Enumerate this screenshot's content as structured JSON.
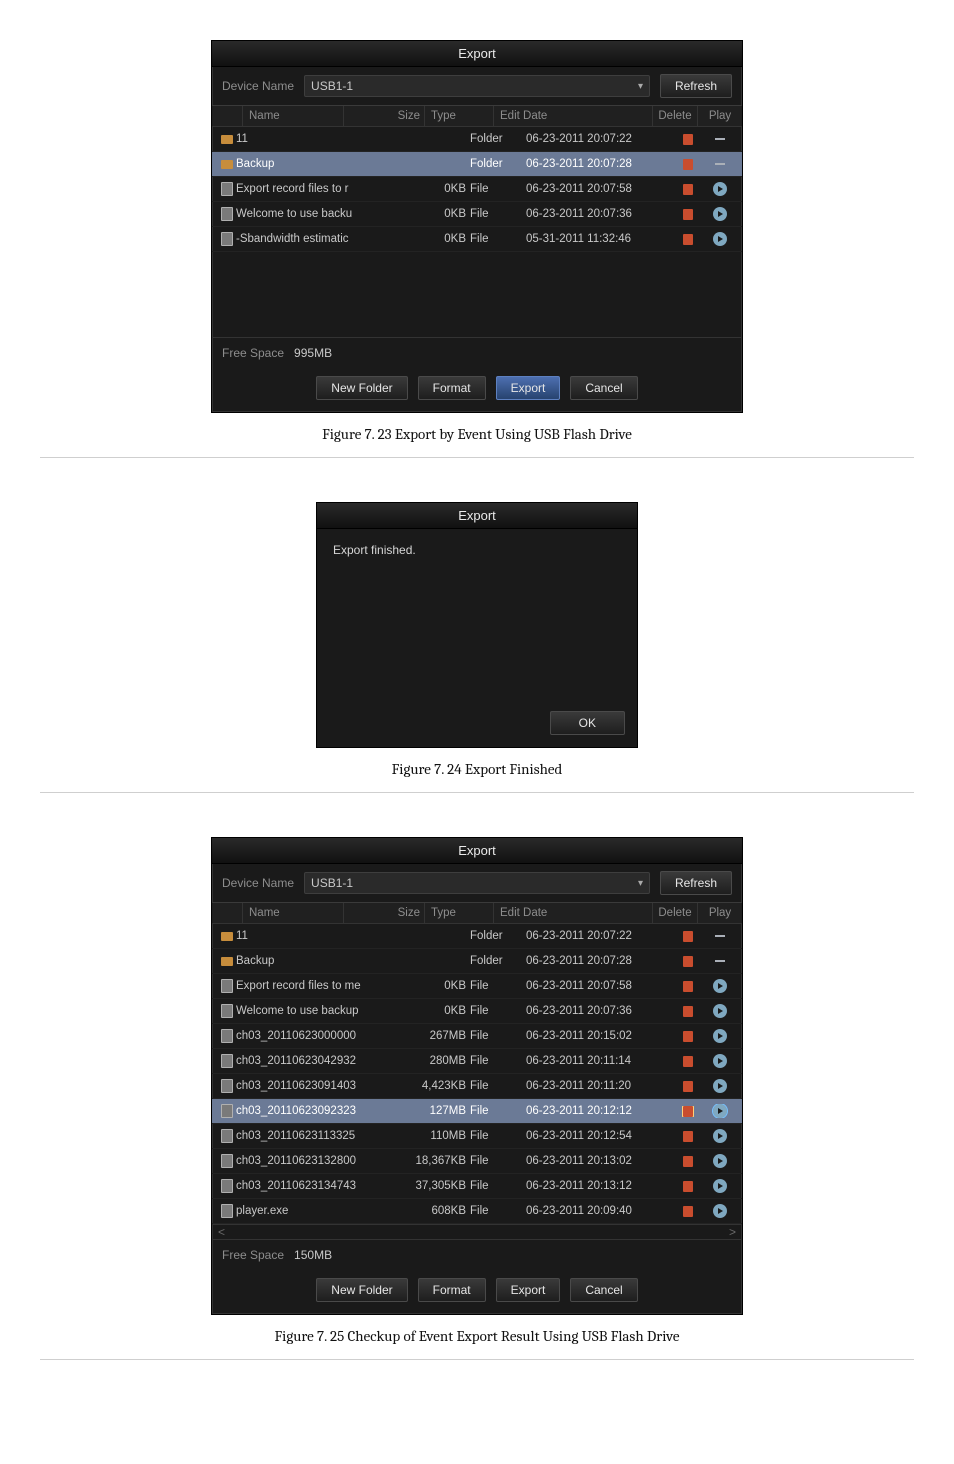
{
  "captions": {
    "fig7_23": "Figure 7. 23 Export by Event Using USB Flash Drive",
    "fig7_24": "Figure 7. 24 Export Finished",
    "fig7_25": "Figure 7. 25  Checkup of Event Export Result Using USB Flash Drive"
  },
  "win_export": {
    "title": "Export",
    "device_label": "Device Name",
    "device_value": "USB1-1",
    "refresh": "Refresh",
    "headers": {
      "name": "Name",
      "size": "Size",
      "type": "Type",
      "date": "Edit Date",
      "del": "Delete",
      "play": "Play"
    },
    "free_label": "Free Space",
    "buttons": {
      "new_folder": "New Folder",
      "format": "Format",
      "export": "Export",
      "cancel": "Cancel",
      "ok": "OK"
    }
  },
  "win1": {
    "free_value": "995MB",
    "rows": [
      {
        "icon": "folder",
        "name": "11",
        "size": "",
        "type": "Folder",
        "date": "06-23-2011 20:07:22",
        "play": "dash"
      },
      {
        "icon": "folder",
        "name": "Backup",
        "size": "",
        "type": "Folder",
        "date": "06-23-2011 20:07:28",
        "play": "dash",
        "sel": true
      },
      {
        "icon": "file",
        "name": "Export record files to r",
        "size": "0KB",
        "type": "File",
        "date": "06-23-2011 20:07:58",
        "play": "play"
      },
      {
        "icon": "file",
        "name": "Welcome to use backu",
        "size": "0KB",
        "type": "File",
        "date": "06-23-2011 20:07:36",
        "play": "play"
      },
      {
        "icon": "file",
        "name": "-Sbandwidth estimatic",
        "size": "0KB",
        "type": "File",
        "date": "05-31-2011 11:32:46",
        "play": "play"
      }
    ]
  },
  "modal": {
    "title": "Export",
    "message": "Export finished."
  },
  "win3": {
    "free_value": "150MB",
    "rows": [
      {
        "icon": "folder",
        "name": "11",
        "size": "",
        "type": "Folder",
        "date": "06-23-2011 20:07:22",
        "play": "dash"
      },
      {
        "icon": "folder",
        "name": "Backup",
        "size": "",
        "type": "Folder",
        "date": "06-23-2011 20:07:28",
        "play": "dash"
      },
      {
        "icon": "file",
        "name": "Export record files to me",
        "size": "0KB",
        "type": "File",
        "date": "06-23-2011 20:07:58",
        "play": "play"
      },
      {
        "icon": "file",
        "name": "Welcome to use backup",
        "size": "0KB",
        "type": "File",
        "date": "06-23-2011 20:07:36",
        "play": "play"
      },
      {
        "icon": "file",
        "name": "ch03_20110623000000",
        "size": "267MB",
        "type": "File",
        "date": "06-23-2011 20:15:02",
        "play": "play"
      },
      {
        "icon": "file",
        "name": "ch03_20110623042932",
        "size": "280MB",
        "type": "File",
        "date": "06-23-2011 20:11:14",
        "play": "play"
      },
      {
        "icon": "file",
        "name": "ch03_20110623091403",
        "size": "4,423KB",
        "type": "File",
        "date": "06-23-2011 20:11:20",
        "play": "play"
      },
      {
        "icon": "file",
        "name": "ch03_20110623092323",
        "size": "127MB",
        "type": "File",
        "date": "06-23-2011 20:12:12",
        "play": "play",
        "sel": true,
        "hl": true
      },
      {
        "icon": "file",
        "name": "ch03_20110623113325",
        "size": "110MB",
        "type": "File",
        "date": "06-23-2011 20:12:54",
        "play": "play"
      },
      {
        "icon": "file",
        "name": "ch03_20110623132800",
        "size": "18,367KB",
        "type": "File",
        "date": "06-23-2011 20:13:02",
        "play": "play"
      },
      {
        "icon": "file",
        "name": "ch03_20110623134743",
        "size": "37,305KB",
        "type": "File",
        "date": "06-23-2011 20:13:12",
        "play": "play"
      },
      {
        "icon": "file",
        "name": "player.exe",
        "size": "608KB",
        "type": "File",
        "date": "06-23-2011 20:09:40",
        "play": "play"
      }
    ]
  }
}
